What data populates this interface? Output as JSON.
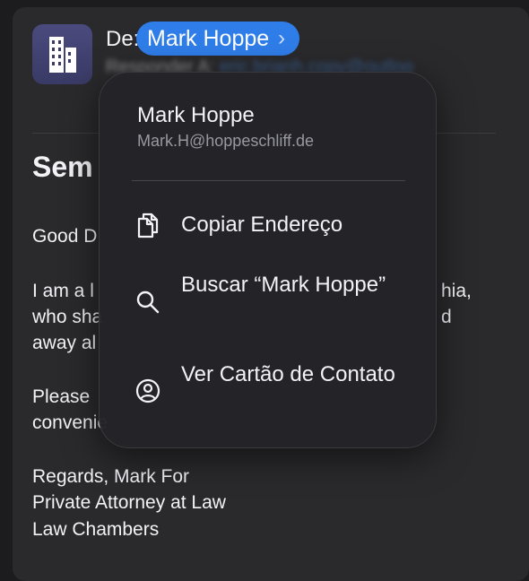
{
  "header": {
    "from_label": "De:",
    "sender_name": "Mark Hoppe",
    "reply_label": "Responder A:",
    "reply_address": "eric.brianh.copy@outloo"
  },
  "message": {
    "subject": "Sem",
    "lines": [
      "Good D",
      "I am a l",
      "who sha",
      "away al",
      "Please",
      "convenie",
      "Regards, Mark For",
      "Private Attorney at Law",
      "Law Chambers"
    ],
    "right_fragments": [
      "hia,",
      "d"
    ]
  },
  "context_menu": {
    "contact_name": "Mark Hoppe",
    "contact_email": "Mark.H@hoppeschliff.de",
    "items": [
      {
        "label": "Copiar Endereço",
        "icon": "copy-document-icon"
      },
      {
        "label": "Buscar “Mark Hoppe”",
        "icon": "search-icon"
      },
      {
        "label": "Ver Cartão de Contato",
        "icon": "contact-card-icon"
      }
    ]
  },
  "colors": {
    "accent": "#2f7de8",
    "link": "#4a8fe6",
    "background": "#1c1c1e"
  }
}
